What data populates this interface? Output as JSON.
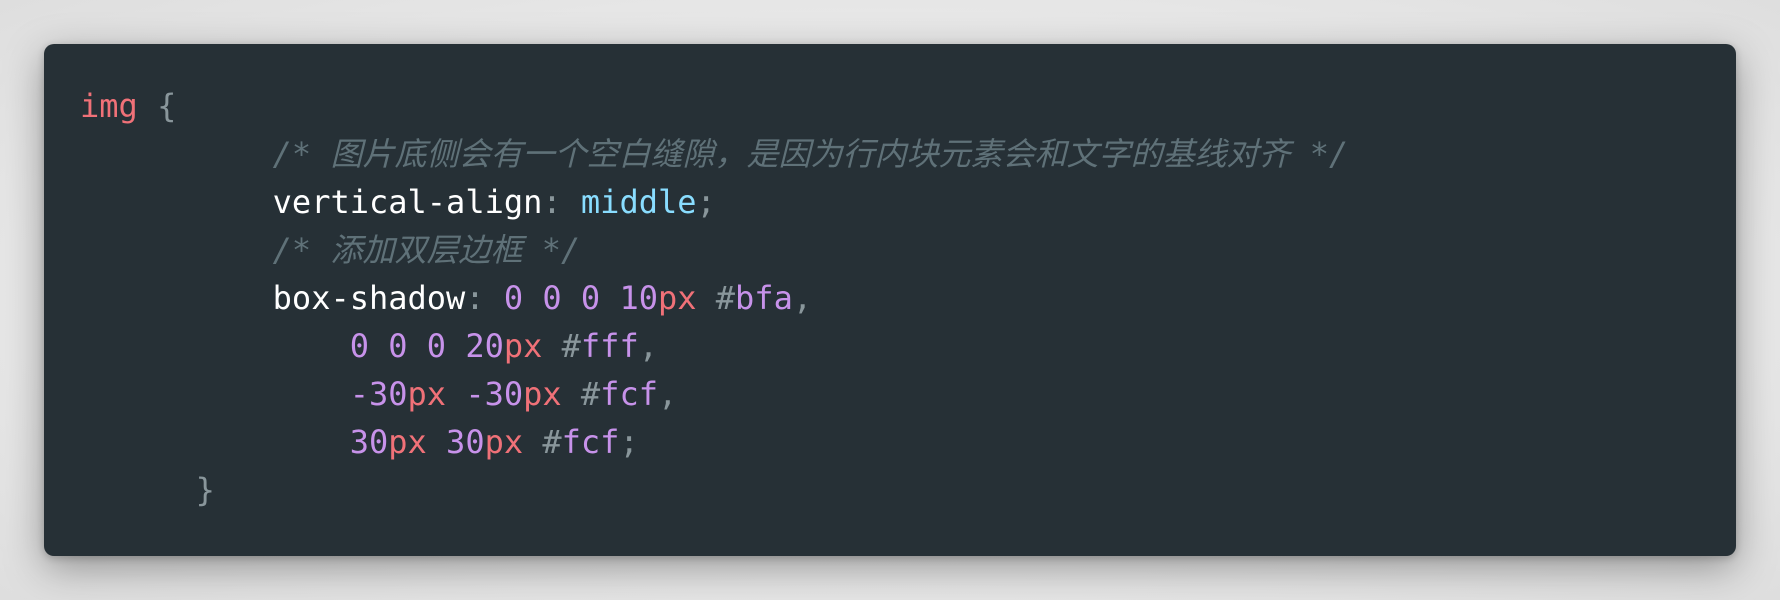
{
  "code": {
    "lines": [
      [
        {
          "t": "img",
          "k": "selector"
        },
        {
          "t": " ",
          "k": "ws"
        },
        {
          "t": "{",
          "k": "punct"
        }
      ],
      [
        {
          "t": "          ",
          "k": "ws"
        },
        {
          "t": "/* 图片底侧会有一个空白缝隙，是因为行内块元素会和文字的基线对齐 */",
          "k": "comment"
        }
      ],
      [
        {
          "t": "          ",
          "k": "ws"
        },
        {
          "t": "vertical-align",
          "k": "prop"
        },
        {
          "t": ": ",
          "k": "punct"
        },
        {
          "t": "middle",
          "k": "value"
        },
        {
          "t": ";",
          "k": "punct"
        }
      ],
      [
        {
          "t": "          ",
          "k": "ws"
        },
        {
          "t": "/* 添加双层边框 */",
          "k": "comment"
        }
      ],
      [
        {
          "t": "          ",
          "k": "ws"
        },
        {
          "t": "box-shadow",
          "k": "prop"
        },
        {
          "t": ": ",
          "k": "punct"
        },
        {
          "t": "0",
          "k": "num"
        },
        {
          "t": " ",
          "k": "ws"
        },
        {
          "t": "0",
          "k": "num"
        },
        {
          "t": " ",
          "k": "ws"
        },
        {
          "t": "0",
          "k": "num"
        },
        {
          "t": " ",
          "k": "ws"
        },
        {
          "t": "10",
          "k": "num"
        },
        {
          "t": "px",
          "k": "unit"
        },
        {
          "t": " ",
          "k": "ws"
        },
        {
          "t": "#",
          "k": "hash"
        },
        {
          "t": "bfa",
          "k": "hex"
        },
        {
          "t": ",",
          "k": "punct"
        }
      ],
      [
        {
          "t": "              ",
          "k": "ws"
        },
        {
          "t": "0",
          "k": "num"
        },
        {
          "t": " ",
          "k": "ws"
        },
        {
          "t": "0",
          "k": "num"
        },
        {
          "t": " ",
          "k": "ws"
        },
        {
          "t": "0",
          "k": "num"
        },
        {
          "t": " ",
          "k": "ws"
        },
        {
          "t": "20",
          "k": "num"
        },
        {
          "t": "px",
          "k": "unit"
        },
        {
          "t": " ",
          "k": "ws"
        },
        {
          "t": "#",
          "k": "hash"
        },
        {
          "t": "fff",
          "k": "hex"
        },
        {
          "t": ",",
          "k": "punct"
        }
      ],
      [
        {
          "t": "              ",
          "k": "ws"
        },
        {
          "t": "-30",
          "k": "num"
        },
        {
          "t": "px",
          "k": "unit"
        },
        {
          "t": " ",
          "k": "ws"
        },
        {
          "t": "-30",
          "k": "num"
        },
        {
          "t": "px",
          "k": "unit"
        },
        {
          "t": " ",
          "k": "ws"
        },
        {
          "t": "#",
          "k": "hash"
        },
        {
          "t": "fcf",
          "k": "hex"
        },
        {
          "t": ",",
          "k": "punct"
        }
      ],
      [
        {
          "t": "              ",
          "k": "ws"
        },
        {
          "t": "30",
          "k": "num"
        },
        {
          "t": "px",
          "k": "unit"
        },
        {
          "t": " ",
          "k": "ws"
        },
        {
          "t": "30",
          "k": "num"
        },
        {
          "t": "px",
          "k": "unit"
        },
        {
          "t": " ",
          "k": "ws"
        },
        {
          "t": "#",
          "k": "hash"
        },
        {
          "t": "fcf",
          "k": "hex"
        },
        {
          "t": ";",
          "k": "punct"
        }
      ],
      [
        {
          "t": "      ",
          "k": "ws"
        },
        {
          "t": "}",
          "k": "punct"
        }
      ]
    ]
  },
  "theme": {
    "background": "#263036",
    "selector": "#f07178",
    "comment": "#5f7178",
    "property": "#ffffff",
    "value": "#89ddff",
    "number": "#c792ea",
    "unit": "#f07178",
    "punctuation": "#89969b"
  }
}
